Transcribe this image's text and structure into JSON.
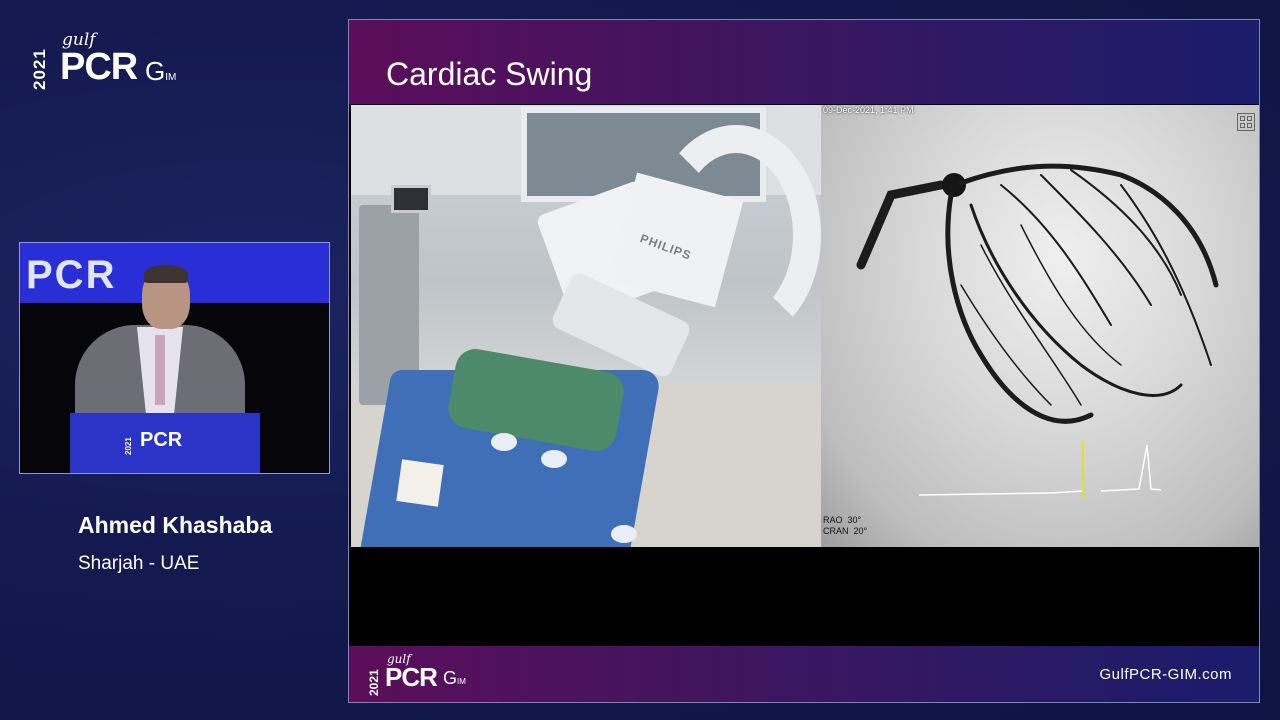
{
  "logo": {
    "year": "2021",
    "gulf": "gulf",
    "pcr": "PCR",
    "gim": "G",
    "gim_suffix": "IM"
  },
  "speaker": {
    "banner_text": "PCR",
    "podium_logo": "PCR",
    "podium_year": "2021",
    "name": "Ahmed Khashaba",
    "location": "Sharjah - UAE"
  },
  "slide": {
    "title": "Cardiac Swing",
    "left_video": {
      "brand": "PHILIPS"
    },
    "right_video": {
      "timestamp": "09-Dec-2021, 1:41 PM",
      "angles": "RAO  30°\nCRAN  20°"
    },
    "footer": {
      "year": "2021",
      "gulf": "gulf",
      "pcr": "PCR",
      "gim": "G",
      "gim_suffix": "IM",
      "url": "GulfPCR-GIM.com"
    }
  },
  "colors": {
    "background": "#141a4f",
    "slide_header_start": "#5c0e5a",
    "slide_header_end": "#1a1d6b",
    "podium": "#2a35c8"
  }
}
